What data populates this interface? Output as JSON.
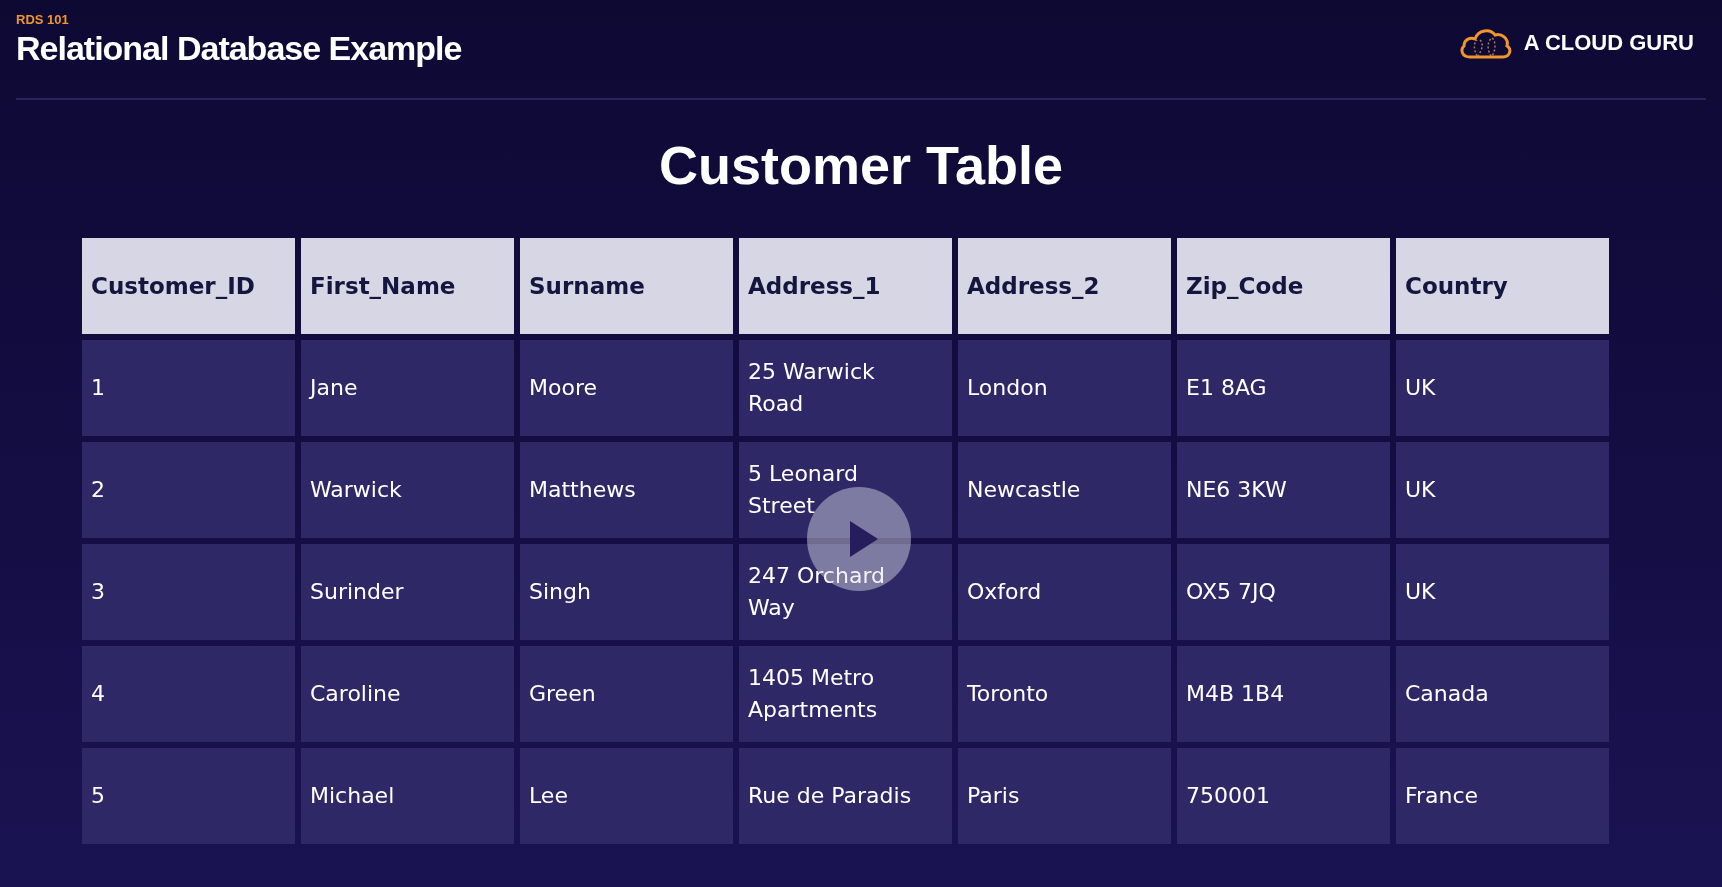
{
  "header": {
    "course": "RDS 101",
    "title": "Relational Database Example",
    "logo_text": "A CLOUD GURU"
  },
  "slide_title": "Customer Table",
  "table": {
    "columns": [
      "Customer_ID",
      "First_Name",
      "Surname",
      "Address_1",
      "Address_2",
      "Zip_Code",
      "Country"
    ],
    "rows": [
      [
        "1",
        "Jane",
        "Moore",
        "25 Warwick Road",
        "London",
        "E1 8AG",
        "UK"
      ],
      [
        "2",
        "Warwick",
        "Matthews",
        "5 Leonard Street",
        "Newcastle",
        "NE6 3KW",
        "UK"
      ],
      [
        "3",
        "Surinder",
        "Singh",
        "247 Orchard Way",
        "Oxford",
        "OX5 7JQ",
        "UK"
      ],
      [
        "4",
        "Caroline",
        "Green",
        "1405 Metro Apartments",
        "Toronto",
        "M4B 1B4",
        "Canada"
      ],
      [
        "5",
        "Michael",
        "Lee",
        "Rue de Paradis",
        "Paris",
        "750001",
        "France"
      ]
    ]
  },
  "player": {
    "playing": false
  }
}
